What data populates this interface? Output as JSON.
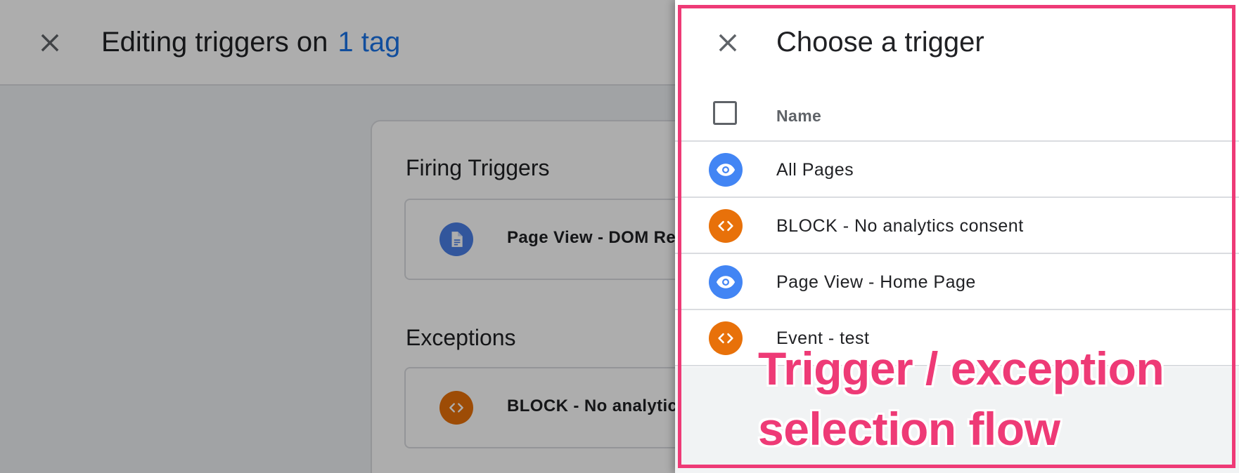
{
  "page": {
    "title_prefix": "Editing triggers on",
    "title_link": "1 tag",
    "firing_triggers_heading": "Firing Triggers",
    "firing_trigger_name": "Page View - DOM Re",
    "exceptions_heading": "Exceptions",
    "exception_name": "BLOCK - No analytic"
  },
  "panel": {
    "title": "Choose a trigger",
    "column_name": "Name",
    "rows": [
      {
        "label": "All Pages",
        "icon": "eye-icon",
        "color": "#4285f4"
      },
      {
        "label": "BLOCK - No analytics consent",
        "icon": "code-icon",
        "color": "#e8710a"
      },
      {
        "label": "Page View - Home Page",
        "icon": "eye-icon",
        "color": "#4285f4"
      },
      {
        "label": "Event - test",
        "icon": "code-icon",
        "color": "#e8710a"
      }
    ]
  },
  "annotation": {
    "line1": "Trigger / exception",
    "line2": "selection flow",
    "color": "#ee3a76"
  }
}
